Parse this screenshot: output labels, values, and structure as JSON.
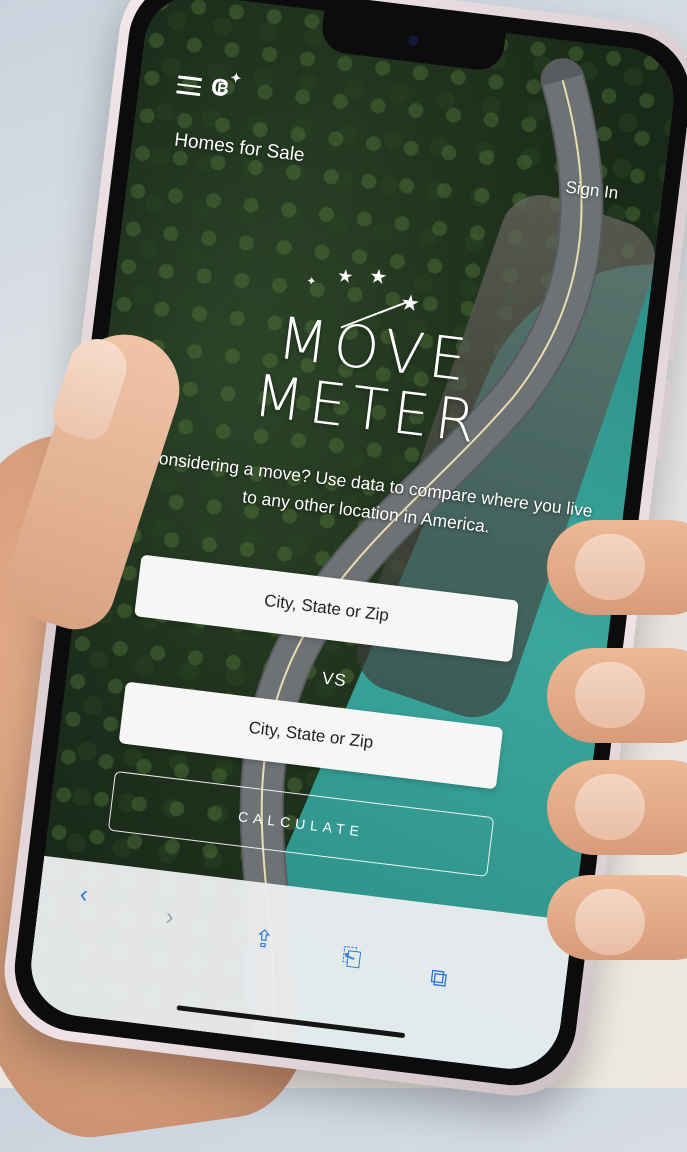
{
  "header": {
    "homes_link": "Homes for Sale",
    "sign_in": "Sign In"
  },
  "brand": {
    "line1": "MOVE",
    "line2": "METER"
  },
  "tagline": "Considering a move? Use data to compare where you live to any other location in America.",
  "form": {
    "location1_placeholder": "City, State or Zip",
    "vs_label": "VS",
    "location2_placeholder": "City, State or Zip",
    "calculate_label": "CALCULATE"
  },
  "browser_toolbar": {
    "icons": [
      "back-icon",
      "forward-icon",
      "share-icon",
      "bookmarks-icon",
      "tabs-icon"
    ],
    "accent_color": "#2f78d7"
  },
  "colors": {
    "lake": "#3aa79c",
    "forest": "#23361f"
  }
}
